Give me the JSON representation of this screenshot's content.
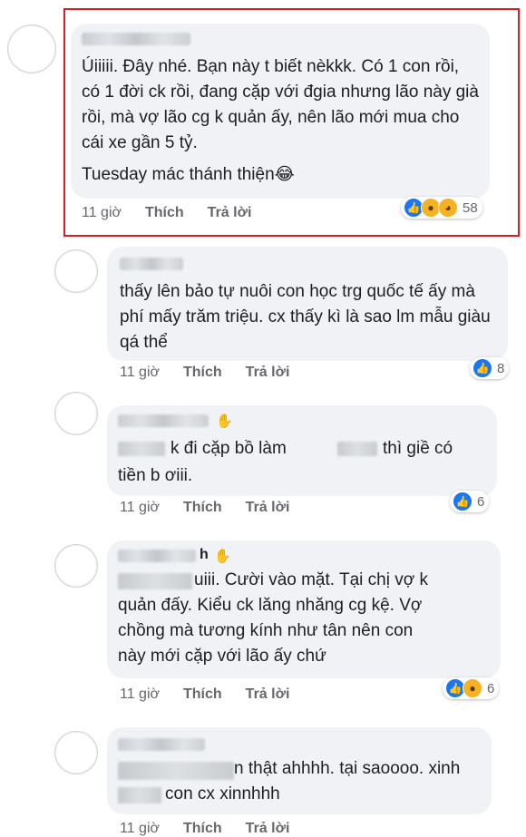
{
  "comments": [
    {
      "text": "Úiiiii. Đây nhé. Bạn này t biết nèkkk. Có 1 con rồi, có 1 đời ck rồi, đang cặp với đgia nhưng lão này già rồi, mà vợ lão cg k quản ấy, nên lão mới mua cho cái xe gần 5 tỷ.",
      "text2": "Tuesday mác thánh thiện😂",
      "time": "11 giờ",
      "like": "Thích",
      "reply": "Trả lời",
      "reaction_icons": [
        "like-icon",
        "wow-icon",
        "haha-icon"
      ],
      "reaction_count": "58"
    },
    {
      "text": "thấy lên bảo tự nuôi con học trg quốc tế ấy mà phí mấy trăm triệu. cx thấy kì là sao lm mẫu giàu qá thể",
      "time": "11 giờ",
      "like": "Thích",
      "reply": "Trả lời",
      "reaction_icons": [
        "like-icon"
      ],
      "reaction_count": "8"
    },
    {
      "text_a": "k đi cặp bồ làm",
      "text_b": "thì giề có",
      "text_c": "tiền b ơiii.",
      "time": "11 giờ",
      "like": "Thích",
      "reply": "Trả lời",
      "reaction_icons": [
        "like-icon"
      ],
      "reaction_count": "6"
    },
    {
      "name_tail": "h",
      "text_a": "uiii. Cười vào mặt. Tại chị vợ k",
      "text_b": "quản đấy. Kiểu ck lăng nhăng cg kệ. Vợ\nchồng mà tương kính như tân nên con\nnày mới cặp với lão ấy chứ",
      "time": "11 giờ",
      "like": "Thích",
      "reply": "Trả lời",
      "reaction_icons": [
        "like-icon",
        "wow-icon"
      ],
      "reaction_count": "6"
    },
    {
      "text_a": "n thật ahhhh. tại saoooo. xinh",
      "text_b": "con cx xinnhhh",
      "time": "11 giờ",
      "like": "Thích",
      "reply": "Trả lời"
    }
  ],
  "colors": {
    "highlight": "#d82027",
    "bubble": "#f0f2f5",
    "like": "#1877f2",
    "wow": "#f7b125"
  }
}
